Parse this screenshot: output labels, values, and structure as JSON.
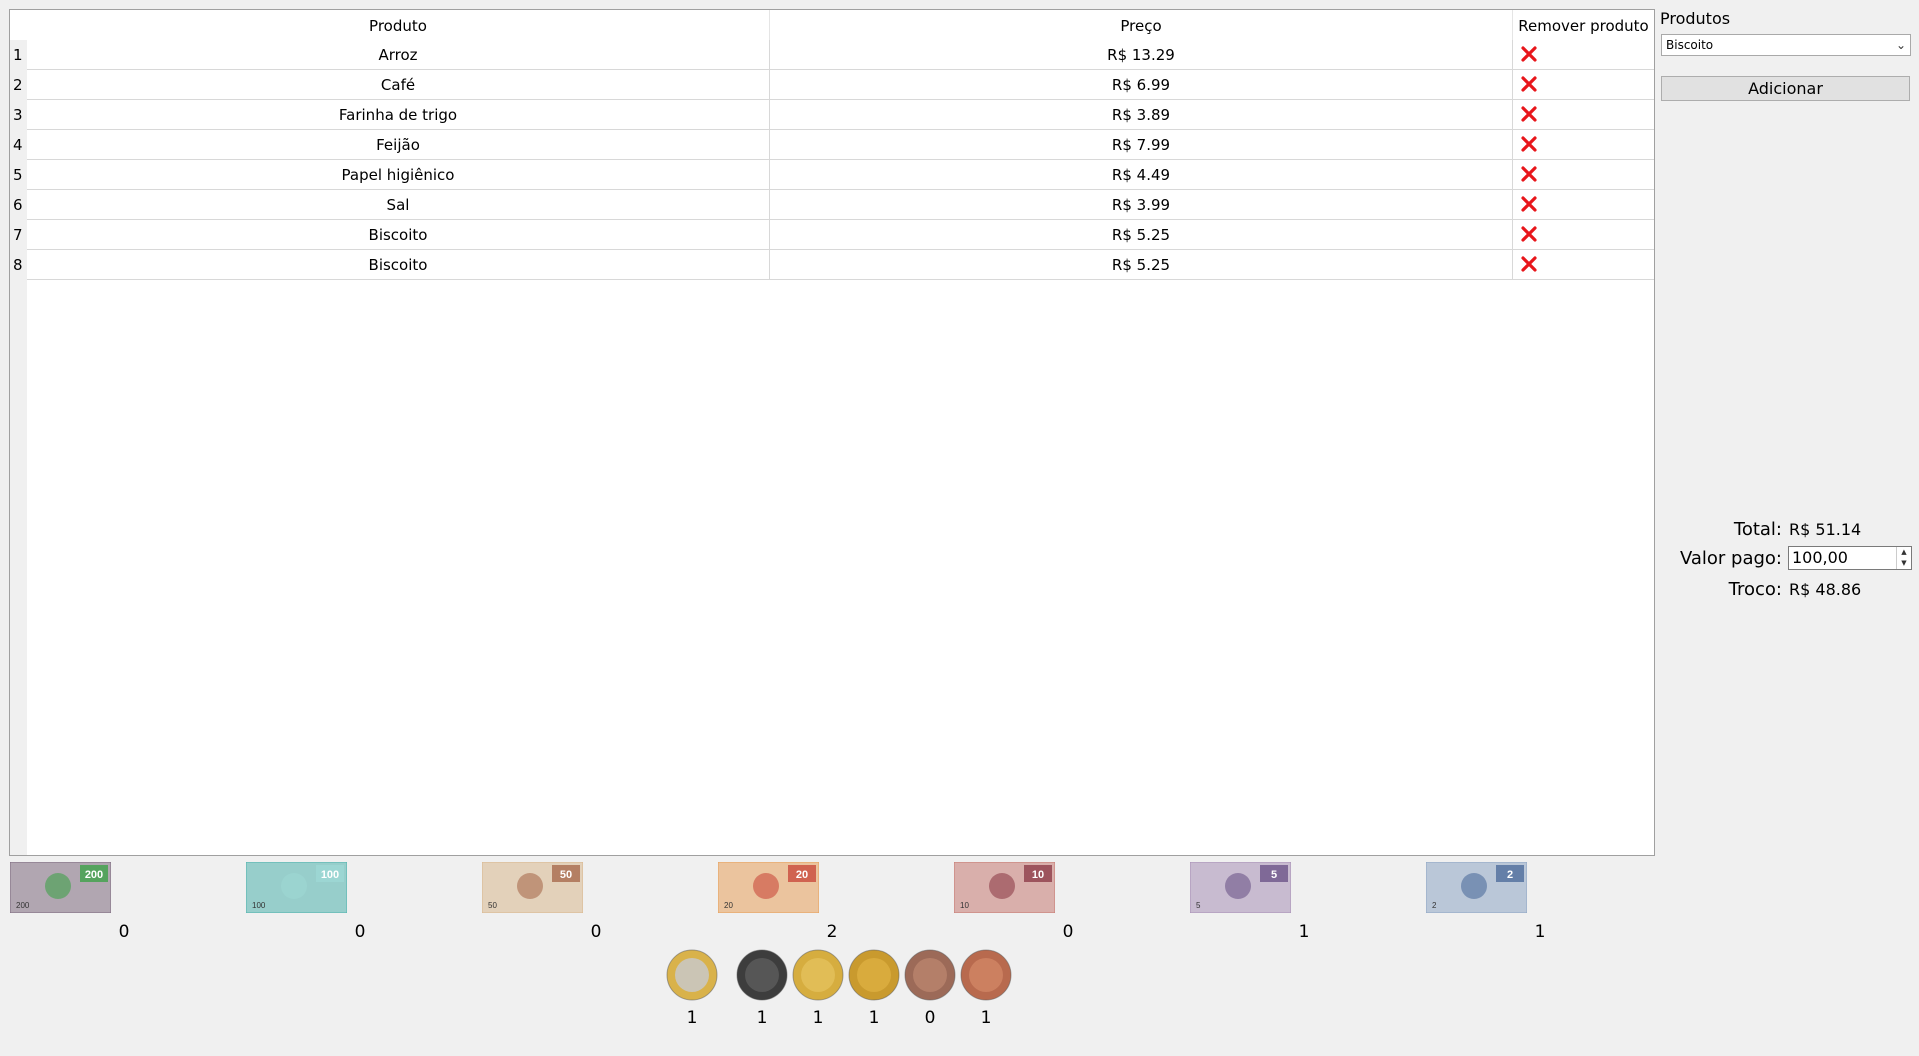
{
  "table": {
    "headers": {
      "product": "Produto",
      "price": "Preço",
      "remove": "Remover produto"
    },
    "rows": [
      {
        "num": "1",
        "product": "Arroz",
        "price": "R$ 13.29"
      },
      {
        "num": "2",
        "product": "Café",
        "price": "R$ 6.99"
      },
      {
        "num": "3",
        "product": "Farinha de trigo",
        "price": "R$ 3.89"
      },
      {
        "num": "4",
        "product": "Feijão",
        "price": "R$ 7.99"
      },
      {
        "num": "5",
        "product": "Papel higiênico",
        "price": "R$ 4.49"
      },
      {
        "num": "6",
        "product": "Sal",
        "price": "R$ 3.99"
      },
      {
        "num": "7",
        "product": "Biscoito",
        "price": "R$ 5.25"
      },
      {
        "num": "8",
        "product": "Biscoito",
        "price": "R$ 5.25"
      }
    ],
    "remove_icon": "red-x-icon"
  },
  "side": {
    "title": "Produtos",
    "select_value": "Biscoito",
    "add_label": "Adicionar"
  },
  "summary": {
    "total_label": "Total:",
    "total_value": "R$ 51.14",
    "paid_label": "Valor pago:",
    "paid_value": "100,00",
    "change_label": "Troco:",
    "change_value": "R$ 48.86"
  },
  "notes": [
    {
      "value": "200",
      "count": "0",
      "color": "#7d6a7e",
      "accent": "#3fa24a"
    },
    {
      "value": "100",
      "count": "0",
      "color": "#4fb3ad",
      "accent": "#9ed8d4"
    },
    {
      "value": "50",
      "count": "0",
      "color": "#d9b88e",
      "accent": "#a86a4e"
    },
    {
      "value": "20",
      "count": "2",
      "color": "#e7a05b",
      "accent": "#c94b3c"
    },
    {
      "value": "10",
      "count": "0",
      "color": "#c77a72",
      "accent": "#8d3d4a"
    },
    {
      "value": "5",
      "count": "1",
      "color": "#a88fb6",
      "accent": "#6d5588"
    },
    {
      "value": "2",
      "count": "1",
      "color": "#8ea5c4",
      "accent": "#4f6d9c"
    }
  ],
  "coins": [
    {
      "name": "coin-1-real",
      "count": "1",
      "outer": "#d9b24a",
      "inner": "#c8c8c8"
    },
    {
      "name": "coin-50-centavos",
      "count": "1",
      "outer": "#3d3d3d",
      "inner": "#5a5a5a"
    },
    {
      "name": "coin-25-centavos",
      "count": "1",
      "outer": "#d6ad3f",
      "inner": "#e3c05a"
    },
    {
      "name": "coin-10-centavos",
      "count": "1",
      "outer": "#c99a2e",
      "inner": "#dcae3f"
    },
    {
      "name": "coin-5-centavos",
      "count": "0",
      "outer": "#9c6a58",
      "inner": "#b9826c"
    },
    {
      "name": "coin-1-centavo",
      "count": "1",
      "outer": "#b86a4e",
      "inner": "#cf8464"
    }
  ]
}
